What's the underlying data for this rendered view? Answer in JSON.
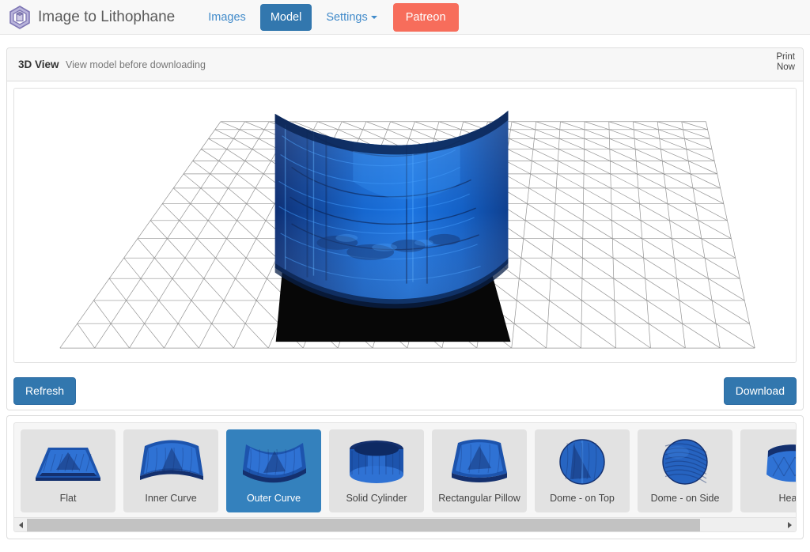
{
  "navbar": {
    "logo_icon": "hexagon-cube-logo-icon",
    "brand": "Image to Lithophane",
    "links": [
      {
        "label": "Images",
        "type": "link",
        "name": "nav-link-images"
      },
      {
        "label": "Model",
        "type": "button-primary",
        "name": "nav-button-model"
      },
      {
        "label": "Settings",
        "type": "dropdown",
        "name": "nav-dropdown-settings"
      },
      {
        "label": "Patreon",
        "type": "button-patreon",
        "name": "nav-button-patreon"
      }
    ],
    "colors": {
      "navbar_bg": "#f8f8f8",
      "link": "#428bca",
      "model_button": "#3277ae",
      "patreon_button": "#f76d5b"
    }
  },
  "panel": {
    "title": "3D View",
    "subtitle": "View model before downloading",
    "print_now_line1": "Print",
    "print_now_line2": "Now"
  },
  "viewer": {
    "model_name": "outer-curve-lithophane",
    "model_color": "#1565d8",
    "shadow_color": "#000000",
    "bed_grid_color": "#8a8a8a",
    "background": "#ffffff"
  },
  "actions": {
    "refresh_label": "Refresh",
    "download_label": "Download"
  },
  "shapes": {
    "selected_index": 2,
    "items": [
      {
        "label": "Flat",
        "art": "flat",
        "selected": false
      },
      {
        "label": "Inner Curve",
        "art": "inner-curve",
        "selected": false
      },
      {
        "label": "Outer Curve",
        "art": "outer-curve",
        "selected": true
      },
      {
        "label": "Solid Cylinder",
        "art": "solid-cylinder",
        "selected": false
      },
      {
        "label": "Rectangular Pillow",
        "art": "rectangular-pillow",
        "selected": false
      },
      {
        "label": "Dome - on Top",
        "art": "dome-top",
        "selected": false
      },
      {
        "label": "Dome - on Side",
        "art": "dome-side",
        "selected": false
      },
      {
        "label": "Hea",
        "art": "heart",
        "selected": false
      }
    ]
  },
  "scrollbar": {
    "left_arrow_icon": "caret-left-icon",
    "right_arrow_icon": "caret-right-icon",
    "thumb_width_percent": "89%"
  }
}
